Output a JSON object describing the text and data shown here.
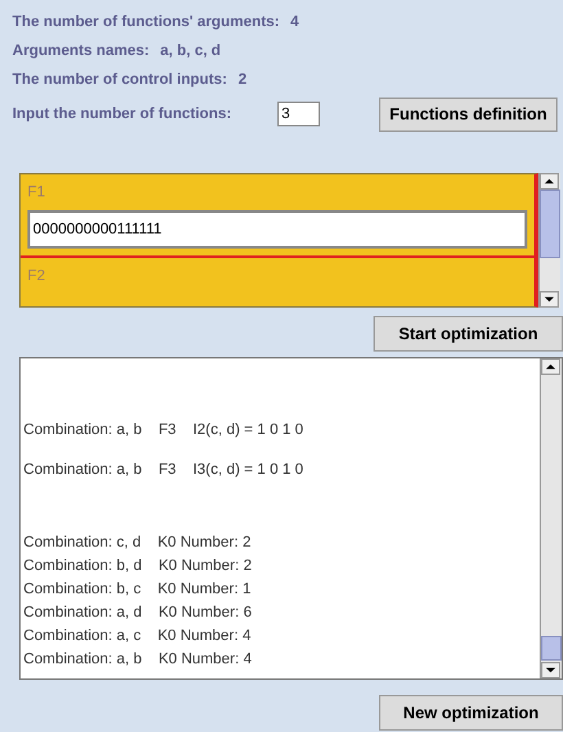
{
  "info_lines": [
    {
      "label": "The number of functions' arguments:",
      "value": "4"
    },
    {
      "label": "Arguments names:",
      "value": "a, b, c, d"
    },
    {
      "label": "The number of control inputs:",
      "value": "2"
    }
  ],
  "function_count": {
    "label": "Input the number of functions:",
    "value": "3"
  },
  "functions_button": "Functions definition",
  "functions": [
    {
      "label": "F1",
      "value": "0000000000111111"
    },
    {
      "label": "F2"
    }
  ],
  "start_button": "Start optimization",
  "output": [
    {
      "kind": "result",
      "text": "Combination: a, b    F3    I2(c, d) = 1 0 1 0"
    },
    {
      "kind": "result",
      "text": "Combination: a, b    F3    I3(c, d) = 1 0 1 0"
    },
    {
      "kind": "count",
      "text": "Combination: c, d    K0 Number: 2"
    },
    {
      "kind": "count",
      "text": "Combination: b, d    K0 Number: 2"
    },
    {
      "kind": "count",
      "text": "Combination: b, c    K0 Number: 1"
    },
    {
      "kind": "count",
      "text": "Combination: a, d    K0 Number: 6"
    },
    {
      "kind": "count",
      "text": "Combination: a, c    K0 Number: 4"
    },
    {
      "kind": "count",
      "text": "Combination: a, b    K0 Number: 4"
    }
  ],
  "new_button": "New optimization"
}
